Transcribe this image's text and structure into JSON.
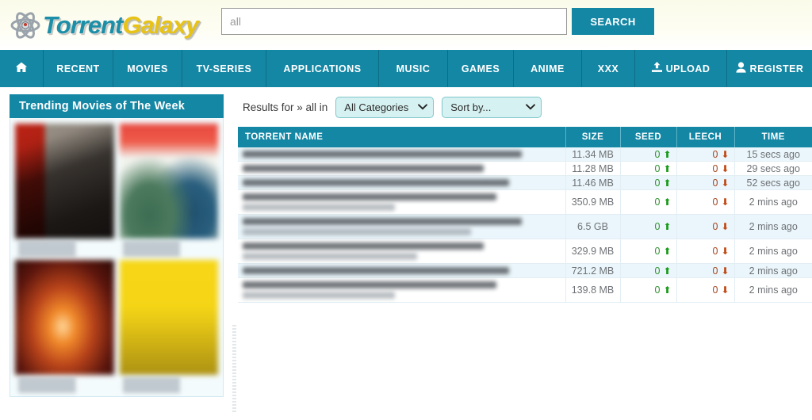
{
  "site": {
    "logo_part1": "Torrent",
    "logo_part2": "Galaxy",
    "logo_icon": "atom-icon"
  },
  "search": {
    "value": "all",
    "placeholder": "all",
    "button_label": "SEARCH"
  },
  "nav": {
    "home_icon": "home-icon",
    "items": [
      {
        "label": "RECENT",
        "id": "recent",
        "icon": null
      },
      {
        "label": "MOVIES",
        "id": "movies",
        "icon": null
      },
      {
        "label": "TV-SERIES",
        "id": "tvseries",
        "icon": null
      },
      {
        "label": "APPLICATIONS",
        "id": "applications",
        "icon": null
      },
      {
        "label": "MUSIC",
        "id": "music",
        "icon": null
      },
      {
        "label": "GAMES",
        "id": "games",
        "icon": null
      },
      {
        "label": "ANIME",
        "id": "anime",
        "icon": null
      },
      {
        "label": "XXX",
        "id": "xxx",
        "icon": null
      },
      {
        "label": "UPLOAD",
        "id": "upload",
        "icon": "upload-icon"
      },
      {
        "label": "REGISTER",
        "id": "register",
        "icon": "user-icon"
      }
    ]
  },
  "sidebar": {
    "title": "Trending Movies of The Week",
    "posters": [
      {
        "id": "poster-1",
        "caption": ""
      },
      {
        "id": "poster-2",
        "caption": ""
      },
      {
        "id": "poster-3",
        "caption": ""
      },
      {
        "id": "poster-4",
        "caption": ""
      }
    ]
  },
  "results": {
    "label": "Results for » all in",
    "category_selected": "All Categories",
    "sort_selected": "Sort by...",
    "caret_icon": "chevron-down-icon"
  },
  "table": {
    "headers": {
      "name": "TORRENT NAME",
      "size": "SIZE",
      "seed": "SEED",
      "leech": "LEECH",
      "time": "TIME"
    },
    "seed_icon": "arrow-up-icon",
    "leech_icon": "arrow-down-icon",
    "rows": [
      {
        "name": "",
        "name_lines": 1,
        "size": "11.34 MB",
        "seed": "0",
        "leech": "0",
        "time": "15 secs ago"
      },
      {
        "name": "",
        "name_lines": 1,
        "size": "11.28 MB",
        "seed": "0",
        "leech": "0",
        "time": "29 secs ago"
      },
      {
        "name": "",
        "name_lines": 1,
        "size": "11.46 MB",
        "seed": "0",
        "leech": "0",
        "time": "52 secs ago"
      },
      {
        "name": "",
        "name_lines": 2,
        "size": "350.9 MB",
        "seed": "0",
        "leech": "0",
        "time": "2 mins ago"
      },
      {
        "name": "",
        "name_lines": 2,
        "size": "6.5 GB",
        "seed": "0",
        "leech": "0",
        "time": "2 mins ago"
      },
      {
        "name": "",
        "name_lines": 2,
        "size": "329.9 MB",
        "seed": "0",
        "leech": "0",
        "time": "2 mins ago"
      },
      {
        "name": "",
        "name_lines": 1,
        "size": "721.2 MB",
        "seed": "0",
        "leech": "0",
        "time": "2 mins ago"
      },
      {
        "name": "",
        "name_lines": 2,
        "size": "139.8 MB",
        "seed": "0",
        "leech": "0",
        "time": "2 mins ago"
      }
    ]
  },
  "colors": {
    "accent_teal": "#1487a5",
    "header_cream": "#fbfbea",
    "row_alt": "#eaf6fb",
    "seed_green": "#2f8f2f",
    "leech_red": "#a5421c",
    "logo_blue": "#1b8fa8",
    "logo_yellow": "#e8c317",
    "select_bg": "#d6f1f1"
  }
}
